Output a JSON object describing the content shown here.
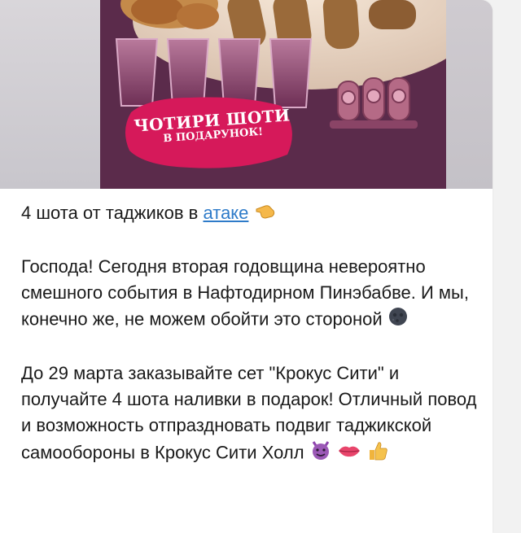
{
  "poster": {
    "badge_line1": "ЧОТИРИ ШОТИ",
    "badge_line2": "В ПОДАРУНОК!"
  },
  "post": {
    "line1_text": "4 шота от таджиков в ",
    "line1_link": "атаке",
    "line1_emoji": "pointing-hand-emoji",
    "paragraph2": "Господа! Сегодня вторая годовщина невероятно смешного события в Нафтодирном Пинэбабве. И мы, конечно же, не можем обойти это стороной",
    "paragraph2_emoji": "dark-moon-face-emoji",
    "paragraph3": "До 29 марта заказывайте сет \"Крокус Сити\" и получайте 4 шота наливки в подарок! Отличный повод и возможность отпраздновать подвиг таджикской самообороны в Крокус Сити Холл",
    "paragraph3_emojis": [
      "smiling-devil-emoji",
      "lips-emoji",
      "thumbs-up-emoji"
    ]
  },
  "colors": {
    "link": "#2e7bc9",
    "poster_bg": "#5a2a4a",
    "badge": "#d6195a"
  }
}
